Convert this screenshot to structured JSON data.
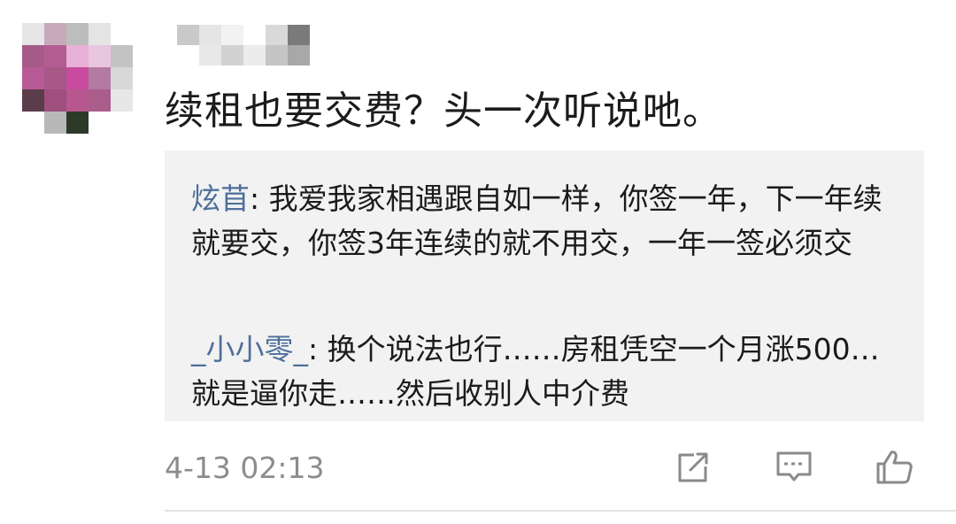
{
  "post": {
    "text": "续租也要交费？头一次听说吔。",
    "timestamp": "4-13 02:13"
  },
  "replies": [
    {
      "name": "炫苜",
      "separator": ": ",
      "text": "我爱我家相遇跟自如一样，你签一年，下一年续就要交，你签3年连续的就不用交，一年一签必须交"
    },
    {
      "name": "_小小零_",
      "separator": ": ",
      "text": "换个说法也行……房租凭空一个月涨500…就是逼你走……然后收别人中介费"
    }
  ],
  "actions": [
    {
      "icon": "share-icon"
    },
    {
      "icon": "comment-icon"
    },
    {
      "icon": "like-icon"
    }
  ],
  "colors": {
    "reply_name": "#4e6f9a",
    "reply_background": "#f2f2f2",
    "text": "#1b1b1b",
    "meta": "#8c8c8c",
    "icon": "#8a8a8a"
  },
  "avatar_mosaic": [
    [
      "#e6e6e6",
      "#c8a9bb",
      "#bdbdbd",
      "#e4e4e4",
      "#ffffff"
    ],
    [
      "#a55a88",
      "#b35c93",
      "#e8b1d6",
      "#e9c6df",
      "#c3c3c3"
    ],
    [
      "#b85a96",
      "#a85887",
      "#c94b9f",
      "#b37aa2",
      "#d8d8d8"
    ],
    [
      "#5a3c4a",
      "#9e4f7e",
      "#b8578f",
      "#a95d8a",
      "#e7e7e7"
    ],
    [
      "#ffffff",
      "#b8b8b8",
      "#2d3a2a",
      "#ffffff",
      "#ffffff"
    ]
  ],
  "username_mosaic": [
    [
      "#c9c9c9",
      "#e5e5e5",
      "#f2f2f2",
      "#ffffff",
      "#d9d9d9",
      "#7a7a7a"
    ],
    [
      "#ffffff",
      "#e8e8e8",
      "#d2d2d2",
      "#ececec",
      "#c5c5c5",
      "#a8a8a8"
    ]
  ]
}
